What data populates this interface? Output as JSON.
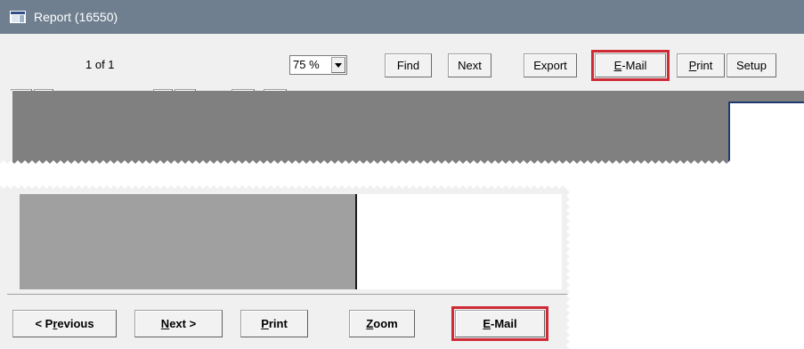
{
  "window": {
    "title": "Report (16550)"
  },
  "toolbar": {
    "first_icon": "first-page-icon",
    "prev_icon": "previous-page-icon",
    "page_label": "1 of 1",
    "next_icon": "next-page-icon",
    "last_icon": "last-page-icon",
    "zoom_out_label": "-",
    "zoom_in_label": "+",
    "zoom_value": "75 %",
    "find_label": "Find",
    "next_label": "Next",
    "export_label": "Export",
    "email_prefix": "E",
    "email_rest": "-Mail",
    "print_prefix": "P",
    "print_rest": "rint",
    "setup_label": "Setup"
  },
  "footer": {
    "previous_prefix": "< P",
    "previous_mnemonic": "r",
    "previous_rest": "evious",
    "next_mnemonic": "N",
    "next_rest": "ext >",
    "print_mnemonic": "P",
    "print_rest": "rint",
    "zoom_mnemonic": "Z",
    "zoom_rest": "oom",
    "email_mnemonic": "E",
    "email_rest": "-Mail"
  },
  "colors": {
    "titlebar": "#6f7f90",
    "highlight": "#cf2b36",
    "preview_background": "#808080"
  }
}
